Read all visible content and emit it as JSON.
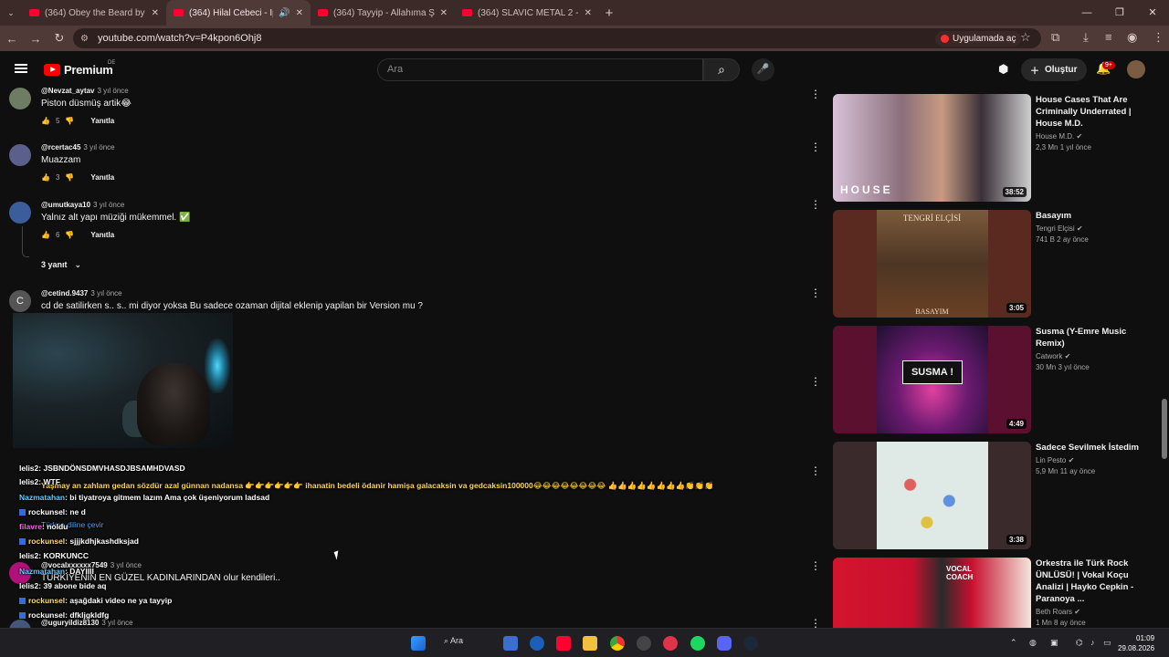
{
  "browser": {
    "tabs": [
      {
        "title": "(364) Obey the Beard by Psych",
        "active": false
      },
      {
        "title": "(364) Hilal Cebeci - İpe İpe",
        "active": true
      },
      {
        "title": "(364) Tayyip - Allahıma Şükür B",
        "active": false
      },
      {
        "title": "(364) SLAVIC METAL 2 - YouTub",
        "active": false
      }
    ],
    "url": "youtube.com/watch?v=P4kpon6Ohj8",
    "open_in_app": "Uygulamada aç"
  },
  "youtube": {
    "logo_text": "Premium",
    "logo_region": "DE",
    "search_placeholder": "Ara",
    "create_label": "Oluştur",
    "notif_count": "9+"
  },
  "comments": [
    {
      "author": "@Nevzat_aytav",
      "time": "3 yıl önce",
      "text": "Piston düsmüş artik😂",
      "likes": "5",
      "reply": "Yanıtla"
    },
    {
      "author": "@rcertac45",
      "time": "3 yıl önce",
      "text": "Muazzam",
      "likes": "3",
      "reply": "Yanıtla"
    },
    {
      "author": "@umutkaya10",
      "time": "3 yıl önce",
      "text": "Yalnız alt yapı müziği mükemmel. ✅",
      "likes": "6",
      "reply": "Yanıtla"
    },
    {
      "author": "@cetind.9437",
      "time": "3 yıl önce",
      "text": "cd de satilirken s.. s.. mi diyor yoksa Bu sadece ozaman dijital eklenip yapilan bir Version mu ?"
    },
    {
      "author": "@vocalxxxxxx7549",
      "time": "3 yıl önce",
      "text": "TÜRKİYENİN EN GÜZEL KADINLARINDAN olur kendileri.."
    },
    {
      "author": "@uguryildiz8130",
      "time": "3 yıl önce",
      "text": ""
    }
  ],
  "replies_toggle": "3 yanıt",
  "chat": [
    {
      "user": "lelis2",
      "msg": ": JSBNDÖNSDMVHASDJBSAMHDVASD"
    },
    {
      "user": "lelis2",
      "msg": ": WTF"
    },
    {
      "user": "Nazmatahan",
      "msg": ": bi tiyatroya gitmem lazım Ama çok üşeniyorum ladsad"
    },
    {
      "user": "rockunsel",
      "msg": ": ne d"
    },
    {
      "user": "filavre",
      "msg": ": noldu"
    },
    {
      "user": "rockunsel",
      "msg": ": sjjjkdhjkashdksjad"
    },
    {
      "user": "lelis2",
      "msg": ": KORKUNCC"
    },
    {
      "user": "Nazmatahan",
      "msg": ": DAYIIII"
    },
    {
      "user": "lelis2",
      "msg": ": 39 abone bide aq"
    },
    {
      "user": "rockunsel",
      "msg": ": aşağdaki video ne ya tayyip"
    },
    {
      "user": "rockunsel",
      "msg": ": dfkljgkldfg"
    }
  ],
  "overlay_comment": "Yaşmay an zahlam gedan sözdür azal günnan nadansa 👉👉👉👉👉👉 ihanatin bedeli ödanir hamişa galacaksin va gedcaksin100000😂😂😂😂😂😂😂😂 👍👍👍👍👍👍👍👍👏👏👏",
  "overlay_translate": "Türkçe diline çevir",
  "sidebar_videos": [
    {
      "title": "House Cases That Are Criminally Underrated | House M.D.",
      "channel": "House M.D.",
      "views": "2,3 Mn",
      "age": "1 yıl önce",
      "duration": "38:52",
      "thumb_text": "HOUSE",
      "bg": "#b9a3b8"
    },
    {
      "title": "Basayım",
      "channel": "Tengri Elçisi",
      "views": "741 B",
      "age": "2 ay önce",
      "duration": "3:05",
      "thumb_text": "TENGRİ ELÇİSİ",
      "thumb_text2": "BASAYIM",
      "bg": "#6a4024"
    },
    {
      "title": "Susma (Y-Emre Music Remix)",
      "channel": "Catwork",
      "views": "30 Mn",
      "age": "3 yıl önce",
      "duration": "4:49",
      "thumb_text": "SUSMA !",
      "bg": "#5b1030"
    },
    {
      "title": "Sadece Sevilmek İstedim",
      "channel": "Lin Pesto",
      "views": "5,9 Mn",
      "age": "11 ay önce",
      "duration": "3:38",
      "thumb_text": "",
      "bg": "#cfe1e3"
    },
    {
      "title": "Orkestra ile Türk Rock ÜNLÜSÜ! | Vokal Koçu Analizi | Hayko Cepkin - Paranoya ...",
      "channel": "Beth Roars",
      "views": "1 Mn",
      "age": "8 ay önce",
      "duration": "",
      "thumb_text": "VOCAL COACH",
      "bg": "#c8102e"
    }
  ],
  "taskbar": {
    "search": "Ara",
    "time": "01:09",
    "date": "29.08.2026"
  },
  "colors": {
    "accent": "#ff0033",
    "chrome": "#4f3a37"
  }
}
